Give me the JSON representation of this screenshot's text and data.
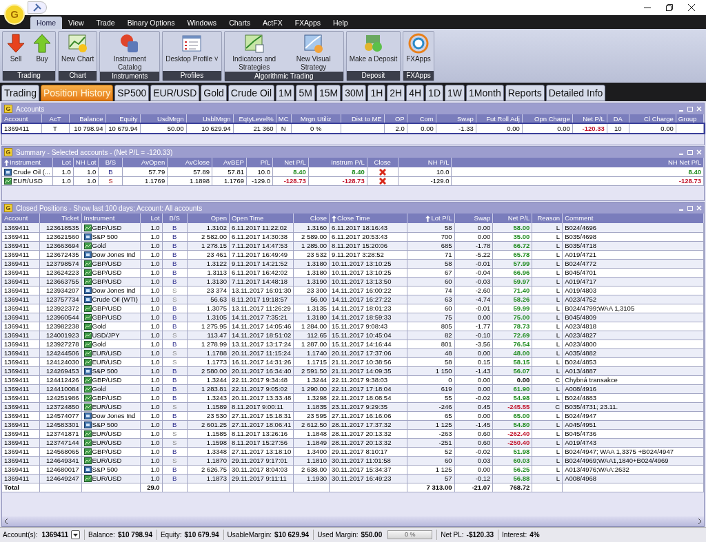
{
  "app": {
    "logo": "G"
  },
  "menu": [
    {
      "label": "Home",
      "selected": true
    },
    {
      "label": "View",
      "selected": false
    },
    {
      "label": "Trade",
      "selected": false
    },
    {
      "label": "Binary Options",
      "selected": false
    },
    {
      "label": "Windows",
      "selected": false
    },
    {
      "label": "Charts",
      "selected": false
    },
    {
      "label": "ActFX",
      "selected": false
    },
    {
      "label": "FXApps",
      "selected": false
    },
    {
      "label": "Help",
      "selected": false
    }
  ],
  "ribbon": [
    {
      "label": "Trading",
      "buttons": [
        {
          "label": "Sell",
          "kind": "sell"
        },
        {
          "label": "Buy",
          "kind": "buy"
        }
      ]
    },
    {
      "label": "Chart",
      "buttons": [
        {
          "label": "New Chart",
          "kind": "chart"
        }
      ]
    },
    {
      "label": "Instruments",
      "buttons": [
        {
          "label": "Instrument Catalog",
          "kind": "catalog"
        }
      ]
    },
    {
      "label": "Profiles",
      "buttons": [
        {
          "label": "Desktop Profile ˅",
          "kind": "profile"
        }
      ]
    },
    {
      "label": "Algorithmic Trading",
      "buttons": [
        {
          "label": "Indicators and Strategies",
          "kind": "indicators"
        },
        {
          "label": "New Visual Strategy",
          "kind": "strategy"
        }
      ]
    },
    {
      "label": "Deposit",
      "buttons": [
        {
          "label": "Make a Deposit",
          "kind": "deposit"
        }
      ]
    },
    {
      "label": "FXApps",
      "buttons": [
        {
          "label": "FXApps",
          "kind": "apps"
        }
      ]
    }
  ],
  "tabs": [
    {
      "label": "Trading",
      "selected": false
    },
    {
      "label": "Position History",
      "selected": true
    },
    {
      "label": "SP500",
      "selected": false
    },
    {
      "label": "EUR/USD",
      "selected": false
    },
    {
      "label": "Gold",
      "selected": false
    },
    {
      "label": "Crude Oil",
      "selected": false
    },
    {
      "label": "1M",
      "selected": false
    },
    {
      "label": "5M",
      "selected": false
    },
    {
      "label": "15M",
      "selected": false
    },
    {
      "label": "30M",
      "selected": false
    },
    {
      "label": "1H",
      "selected": false
    },
    {
      "label": "2H",
      "selected": false
    },
    {
      "label": "4H",
      "selected": false
    },
    {
      "label": "1D",
      "selected": false
    },
    {
      "label": "1W",
      "selected": false
    },
    {
      "label": "1Month",
      "selected": false
    },
    {
      "label": "Reports",
      "selected": false
    },
    {
      "label": "Detailed Info",
      "selected": false
    }
  ],
  "accounts": {
    "logo": "G",
    "title": "Accounts",
    "columns": [
      "Account",
      "AcT",
      "Balance",
      "Equity",
      "UsdMrgn",
      "UsblMrgn",
      "EqtyLevel%",
      "MC",
      "Mrgn Utiliz",
      "Dist to ME",
      "OP",
      "Com",
      "Swap",
      "Fut Roll Adj",
      "Opn Charge",
      "Net P/L",
      "DA",
      "Cl Charge",
      "Group"
    ],
    "rows": [
      {
        "cells": [
          "1369411",
          "T",
          "10 798.94",
          "10 679.94",
          "50.00",
          "10 629.94",
          "21 360",
          "N",
          "0 %",
          "",
          "2.0",
          "0.00",
          "-1.33",
          "0.00",
          "0.00",
          "-120.33",
          "10",
          "0.00",
          ""
        ],
        "selected": true,
        "color": "#c0122a"
      }
    ]
  },
  "summary": {
    "logo": "G",
    "title": "Summary - Selected accounts - (Net P/L = -120.33)",
    "columns": [
      "Instrument",
      "Lot",
      "NH Lot",
      "B/S",
      "AvOpen",
      "AvClose",
      "AvBEP",
      "P/L",
      "Net P/L",
      "Instrum P/L",
      "Close",
      "NH P/L",
      "NH Net P/L"
    ],
    "rows": [
      {
        "instrument": "Crude Oil (...",
        "kind": "index",
        "lot": "1.0",
        "nh_lot": "1.0",
        "bs": "B",
        "buy": true,
        "av_open": "57.79",
        "av_close": "57.89",
        "av_bep": "57.81",
        "pl": "10.0",
        "net_pl": "8.40",
        "instrum_pl": "8.40",
        "nh_pl": "10.0",
        "color": "#1e8a1e",
        "nh_net": "8.40"
      },
      {
        "instrument": "EUR/USD",
        "kind": "fx",
        "lot": "1.0",
        "nh_lot": "1.0",
        "bs": "S",
        "buy": false,
        "av_open": "1.1769",
        "av_close": "1.1898",
        "av_bep": "1.1769",
        "pl": "-129.0",
        "net_pl": "-128.73",
        "instrum_pl": "-128.73",
        "nh_pl": "-129.0",
        "color": "#c0122a",
        "nh_net": "-128.73"
      }
    ]
  },
  "closed": {
    "logo": "G",
    "title": "Closed Positions - Show last 100 days; Account: All accounts",
    "columns": [
      "Account",
      "Ticket",
      "Instrument",
      "Lot",
      "B/S",
      "Open",
      "Open Time",
      "Close",
      "Close Time",
      "Lot P/L",
      "Swap",
      "Net P/L",
      "Reason",
      "Comment"
    ],
    "rows": [
      {
        "account": "1369411",
        "ticket": "123618535",
        "instrument": "GBP/USD",
        "kind": "fx",
        "lot": "1.0",
        "bs": "B",
        "buy": true,
        "open": "1.3102",
        "open_time": "6.11.2017 11:22:02",
        "close": "1.3160",
        "close_time": "6.11.2017 18:16:43",
        "lot_pl": "58",
        "swap": "0.00",
        "net_pl": "58.00",
        "color": "#1e8a1e",
        "reason": "L",
        "comment": "B024/4696"
      },
      {
        "account": "1369411",
        "ticket": "123621560",
        "instrument": "S&P 500",
        "kind": "index",
        "lot": "1.0",
        "bs": "B",
        "buy": true,
        "open": "2 582.00",
        "open_time": "6.11.2017 14:30:38",
        "close": "2 589.00",
        "close_time": "6.11.2017 20:53:43",
        "lot_pl": "700",
        "swap": "0.00",
        "net_pl": "35.00",
        "color": "#1e8a1e",
        "reason": "L",
        "comment": "B035/4698"
      },
      {
        "account": "1369411",
        "ticket": "123663694",
        "instrument": "Gold",
        "kind": "fx",
        "lot": "1.0",
        "bs": "B",
        "buy": true,
        "open": "1 278.15",
        "open_time": "7.11.2017 14:47:53",
        "close": "1 285.00",
        "close_time": "8.11.2017 15:20:06",
        "lot_pl": "685",
        "swap": "-1.78",
        "net_pl": "66.72",
        "color": "#1e8a1e",
        "reason": "L",
        "comment": "B035/4718"
      },
      {
        "account": "1369411",
        "ticket": "123672435",
        "instrument": "Dow Jones Ind",
        "kind": "index",
        "lot": "1.0",
        "bs": "B",
        "buy": true,
        "open": "23 461",
        "open_time": "7.11.2017 16:49:49",
        "close": "23 532",
        "close_time": "9.11.2017 3:28:52",
        "lot_pl": "71",
        "swap": "-5.22",
        "net_pl": "65.78",
        "color": "#1e8a1e",
        "reason": "L",
        "comment": "A019/4721"
      },
      {
        "account": "1369411",
        "ticket": "123798574",
        "instrument": "GBP/USD",
        "kind": "fx",
        "lot": "1.0",
        "bs": "B",
        "buy": true,
        "open": "1.3122",
        "open_time": "9.11.2017 14:21:52",
        "close": "1.3180",
        "close_time": "10.11.2017 13:10:25",
        "lot_pl": "58",
        "swap": "-0.01",
        "net_pl": "57.99",
        "color": "#1e8a1e",
        "reason": "L",
        "comment": "B024/4772"
      },
      {
        "account": "1369411",
        "ticket": "123624223",
        "instrument": "GBP/USD",
        "kind": "fx",
        "lot": "1.0",
        "bs": "B",
        "buy": true,
        "open": "1.3113",
        "open_time": "6.11.2017 16:42:02",
        "close": "1.3180",
        "close_time": "10.11.2017 13:10:25",
        "lot_pl": "67",
        "swap": "-0.04",
        "net_pl": "66.96",
        "color": "#1e8a1e",
        "reason": "L",
        "comment": "B045/4701"
      },
      {
        "account": "1369411",
        "ticket": "123663755",
        "instrument": "GBP/USD",
        "kind": "fx",
        "lot": "1.0",
        "bs": "B",
        "buy": true,
        "open": "1.3130",
        "open_time": "7.11.2017 14:48:18",
        "close": "1.3190",
        "close_time": "10.11.2017 13:13:50",
        "lot_pl": "60",
        "swap": "-0.03",
        "net_pl": "59.97",
        "color": "#1e8a1e",
        "reason": "L",
        "comment": "A019/4717"
      },
      {
        "account": "1369411",
        "ticket": "123934207",
        "instrument": "Dow Jones Ind",
        "kind": "index",
        "lot": "1.0",
        "bs": "S",
        "buy": false,
        "open": "23 374",
        "open_time": "13.11.2017 16:01:30",
        "close": "23 300",
        "close_time": "14.11.2017 16:00:22",
        "lot_pl": "74",
        "swap": "-2.60",
        "net_pl": "71.40",
        "color": "#1e8a1e",
        "reason": "L",
        "comment": "A019/4803"
      },
      {
        "account": "1369411",
        "ticket": "123757734",
        "instrument": "Crude Oil (WTI)",
        "kind": "index",
        "lot": "1.0",
        "bs": "S",
        "buy": false,
        "open": "56.63",
        "open_time": "8.11.2017 19:18:57",
        "close": "56.00",
        "close_time": "14.11.2017 16:27:22",
        "lot_pl": "63",
        "swap": "-4.74",
        "net_pl": "58.26",
        "color": "#1e8a1e",
        "reason": "L",
        "comment": "A023/4752"
      },
      {
        "account": "1369411",
        "ticket": "123922372",
        "instrument": "GBP/USD",
        "kind": "fx",
        "lot": "1.0",
        "bs": "B",
        "buy": true,
        "open": "1.3075",
        "open_time": "13.11.2017 11:26:29",
        "close": "1.3135",
        "close_time": "14.11.2017 18:01:23",
        "lot_pl": "60",
        "swap": "-0.01",
        "net_pl": "59.99",
        "color": "#1e8a1e",
        "reason": "L",
        "comment": "B024/4799;WAA 1,3105"
      },
      {
        "account": "1369411",
        "ticket": "123960544",
        "instrument": "GBP/USD",
        "kind": "fx",
        "lot": "1.0",
        "bs": "B",
        "buy": true,
        "open": "1.3105",
        "open_time": "14.11.2017 7:35:21",
        "close": "1.3180",
        "close_time": "14.11.2017 18:59:33",
        "lot_pl": "75",
        "swap": "0.00",
        "net_pl": "75.00",
        "color": "#1e8a1e",
        "reason": "L",
        "comment": "B045/4809"
      },
      {
        "account": "1369411",
        "ticket": "123982238",
        "instrument": "Gold",
        "kind": "fx",
        "lot": "1.0",
        "bs": "B",
        "buy": true,
        "open": "1 275.95",
        "open_time": "14.11.2017 14:05:46",
        "close": "1 284.00",
        "close_time": "15.11.2017 9:08:43",
        "lot_pl": "805",
        "swap": "-1.77",
        "net_pl": "78.73",
        "color": "#1e8a1e",
        "reason": "L",
        "comment": "A023/4818"
      },
      {
        "account": "1369411",
        "ticket": "124001923",
        "instrument": "USD/JPY",
        "kind": "fx",
        "lot": "1.0",
        "bs": "S",
        "buy": false,
        "open": "113.47",
        "open_time": "14.11.2017 18:51:02",
        "close": "112.65",
        "close_time": "15.11.2017 10:45:04",
        "lot_pl": "82",
        "swap": "-0.10",
        "net_pl": "72.69",
        "color": "#1e8a1e",
        "reason": "L",
        "comment": "A023/4827"
      },
      {
        "account": "1369411",
        "ticket": "123927278",
        "instrument": "Gold",
        "kind": "fx",
        "lot": "1.0",
        "bs": "B",
        "buy": true,
        "open": "1 278.99",
        "open_time": "13.11.2017 13:17:24",
        "close": "1 287.00",
        "close_time": "15.11.2017 14:16:44",
        "lot_pl": "801",
        "swap": "-3.56",
        "net_pl": "76.54",
        "color": "#1e8a1e",
        "reason": "L",
        "comment": "A023/4800"
      },
      {
        "account": "1369411",
        "ticket": "124244506",
        "instrument": "EUR/USD",
        "kind": "fx",
        "lot": "1.0",
        "bs": "S",
        "buy": false,
        "open": "1.1788",
        "open_time": "20.11.2017 11:15:24",
        "close": "1.1740",
        "close_time": "20.11.2017 17:37:06",
        "lot_pl": "48",
        "swap": "0.00",
        "net_pl": "48.00",
        "color": "#1e8a1e",
        "reason": "L",
        "comment": "A035/4882"
      },
      {
        "account": "1369411",
        "ticket": "124124030",
        "instrument": "EUR/USD",
        "kind": "fx",
        "lot": "1.0",
        "bs": "S",
        "buy": false,
        "open": "1.1773",
        "open_time": "16.11.2017 14:31:26",
        "close": "1.1715",
        "close_time": "21.11.2017 10:38:56",
        "lot_pl": "58",
        "swap": "0.15",
        "net_pl": "58.15",
        "color": "#1e8a1e",
        "reason": "L",
        "comment": "B024/4853"
      },
      {
        "account": "1369411",
        "ticket": "124269453",
        "instrument": "S&P 500",
        "kind": "index",
        "lot": "1.0",
        "bs": "B",
        "buy": true,
        "open": "2 580.00",
        "open_time": "20.11.2017 16:34:40",
        "close": "2 591.50",
        "close_time": "21.11.2017 14:09:35",
        "lot_pl": "1 150",
        "swap": "-1.43",
        "net_pl": "56.07",
        "color": "#1e8a1e",
        "reason": "L",
        "comment": "A013/4887"
      },
      {
        "account": "1369411",
        "ticket": "124412426",
        "instrument": "GBP/USD",
        "kind": "fx",
        "lot": "1.0",
        "bs": "B",
        "buy": true,
        "open": "1.3244",
        "open_time": "22.11.2017 9:34:48",
        "close": "1.3244",
        "close_time": "22.11.2017 9:38:03",
        "lot_pl": "0",
        "swap": "0.00",
        "net_pl": "0.00",
        "reason": "C",
        "comment": "Chybná transakce"
      },
      {
        "account": "1369411",
        "ticket": "124410084",
        "instrument": "Gold",
        "kind": "fx",
        "lot": "1.0",
        "bs": "B",
        "buy": true,
        "open": "1 283.81",
        "open_time": "22.11.2017 9:05:02",
        "close": "1 290.00",
        "close_time": "22.11.2017 17:18:04",
        "lot_pl": "619",
        "swap": "0.00",
        "net_pl": "61.90",
        "color": "#1e8a1e",
        "reason": "L",
        "comment": "A008/4916"
      },
      {
        "account": "1369411",
        "ticket": "124251986",
        "instrument": "GBP/USD",
        "kind": "fx",
        "lot": "1.0",
        "bs": "B",
        "buy": true,
        "open": "1.3243",
        "open_time": "20.11.2017 13:33:48",
        "close": "1.3298",
        "close_time": "22.11.2017 18:08:54",
        "lot_pl": "55",
        "swap": "-0.02",
        "net_pl": "54.98",
        "color": "#1e8a1e",
        "reason": "L",
        "comment": "B024/4883"
      },
      {
        "account": "1369411",
        "ticket": "123724850",
        "instrument": "EUR/USD",
        "kind": "fx",
        "lot": "1.0",
        "bs": "S",
        "buy": false,
        "open": "1.1589",
        "open_time": "8.11.2017 9:00:11",
        "close": "1.1835",
        "close_time": "23.11.2017 9:29:35",
        "lot_pl": "-246",
        "swap": "0.45",
        "net_pl": "-245.55",
        "color": "#c0122a",
        "reason": "C",
        "comment": "B035/4731; 23.11."
      },
      {
        "account": "1369411",
        "ticket": "124574077",
        "instrument": "Dow Jones Ind",
        "kind": "index",
        "lot": "1.0",
        "bs": "B",
        "buy": true,
        "open": "23 530",
        "open_time": "27.11.2017 15:18:31",
        "close": "23 595",
        "close_time": "27.11.2017 16:16:06",
        "lot_pl": "65",
        "swap": "0.00",
        "net_pl": "65.00",
        "color": "#1e8a1e",
        "reason": "L",
        "comment": "B024/4947"
      },
      {
        "account": "1369411",
        "ticket": "124583301",
        "instrument": "S&P 500",
        "kind": "index",
        "lot": "1.0",
        "bs": "B",
        "buy": true,
        "open": "2 601.25",
        "open_time": "27.11.2017 18:06:41",
        "close": "2 612.50",
        "close_time": "28.11.2017 17:37:32",
        "lot_pl": "1 125",
        "swap": "-1.45",
        "net_pl": "54.80",
        "color": "#1e8a1e",
        "reason": "L",
        "comment": "A045/4951"
      },
      {
        "account": "1369411",
        "ticket": "123741871",
        "instrument": "EUR/USD",
        "kind": "fx",
        "lot": "1.0",
        "bs": "S",
        "buy": false,
        "open": "1.1585",
        "open_time": "8.11.2017 13:26:16",
        "close": "1.1848",
        "close_time": "28.11.2017 20:13:32",
        "lot_pl": "-263",
        "swap": "0.60",
        "net_pl": "-262.40",
        "color": "#c0122a",
        "reason": "L",
        "comment": "B045/4736"
      },
      {
        "account": "1369411",
        "ticket": "123747144",
        "instrument": "EUR/USD",
        "kind": "fx",
        "lot": "1.0",
        "bs": "S",
        "buy": false,
        "open": "1.1598",
        "open_time": "8.11.2017 15:27:56",
        "close": "1.1849",
        "close_time": "28.11.2017 20:13:32",
        "lot_pl": "-251",
        "swap": "0.60",
        "net_pl": "-250.40",
        "color": "#c0122a",
        "reason": "L",
        "comment": "A019/4743"
      },
      {
        "account": "1369411",
        "ticket": "124568065",
        "instrument": "GBP/USD",
        "kind": "fx",
        "lot": "1.0",
        "bs": "B",
        "buy": true,
        "open": "1.3348",
        "open_time": "27.11.2017 13:18:10",
        "close": "1.3400",
        "close_time": "29.11.2017 8:10:17",
        "lot_pl": "52",
        "swap": "-0.02",
        "net_pl": "51.98",
        "color": "#1e8a1e",
        "reason": "L",
        "comment": "B024/4947; WAA 1,3375 +B024/4947"
      },
      {
        "account": "1369411",
        "ticket": "124649341",
        "instrument": "EUR/USD",
        "kind": "fx",
        "lot": "1.0",
        "bs": "S",
        "buy": false,
        "open": "1.1870",
        "open_time": "29.11.2017 9:17:01",
        "close": "1.1810",
        "close_time": "30.11.2017 11:01:58",
        "lot_pl": "60",
        "swap": "0.03",
        "net_pl": "60.03",
        "color": "#1e8a1e",
        "reason": "L",
        "comment": "B024/4969;WAA1,1840+B024/4969"
      },
      {
        "account": "1369411",
        "ticket": "124680017",
        "instrument": "S&P 500",
        "kind": "index",
        "lot": "1.0",
        "bs": "B",
        "buy": true,
        "open": "2 626.75",
        "open_time": "30.11.2017 8:04:03",
        "close": "2 638.00",
        "close_time": "30.11.2017 15:34:37",
        "lot_pl": "1 125",
        "swap": "0.00",
        "net_pl": "56.25",
        "color": "#1e8a1e",
        "reason": "L",
        "comment": "A013/4976;WAA:2632"
      },
      {
        "account": "1369411",
        "ticket": "124649247",
        "instrument": "EUR/USD",
        "kind": "fx",
        "lot": "1.0",
        "bs": "B",
        "buy": true,
        "open": "1.1873",
        "open_time": "29.11.2017 9:11:11",
        "close": "1.1930",
        "close_time": "30.11.2017 16:49:23",
        "lot_pl": "57",
        "swap": "-0.12",
        "net_pl": "56.88",
        "color": "#1e8a1e",
        "reason": "L",
        "comment": "A008/4968"
      }
    ],
    "total": {
      "label": "Total",
      "lot": "29.0",
      "lot_pl": "7 313.00",
      "swap": "-21.07",
      "net_pl": "768.72"
    }
  },
  "status": {
    "account_label": "Account(s):",
    "account": "1369411",
    "items": [
      {
        "label": "Balance:",
        "value": "$10 798.94"
      },
      {
        "label": "Equity:",
        "value": "$10 679.94"
      },
      {
        "label": "UsableMargin:",
        "value": "$10 629.94"
      },
      {
        "label": "Used Margin:",
        "value": "$50.00"
      }
    ],
    "meter": {
      "level": 0,
      "reading": "0 %"
    },
    "net": {
      "label": "Net PL:",
      "value": "-$120.33"
    },
    "interest": {
      "label": "Interest:",
      "value": "4%"
    }
  }
}
